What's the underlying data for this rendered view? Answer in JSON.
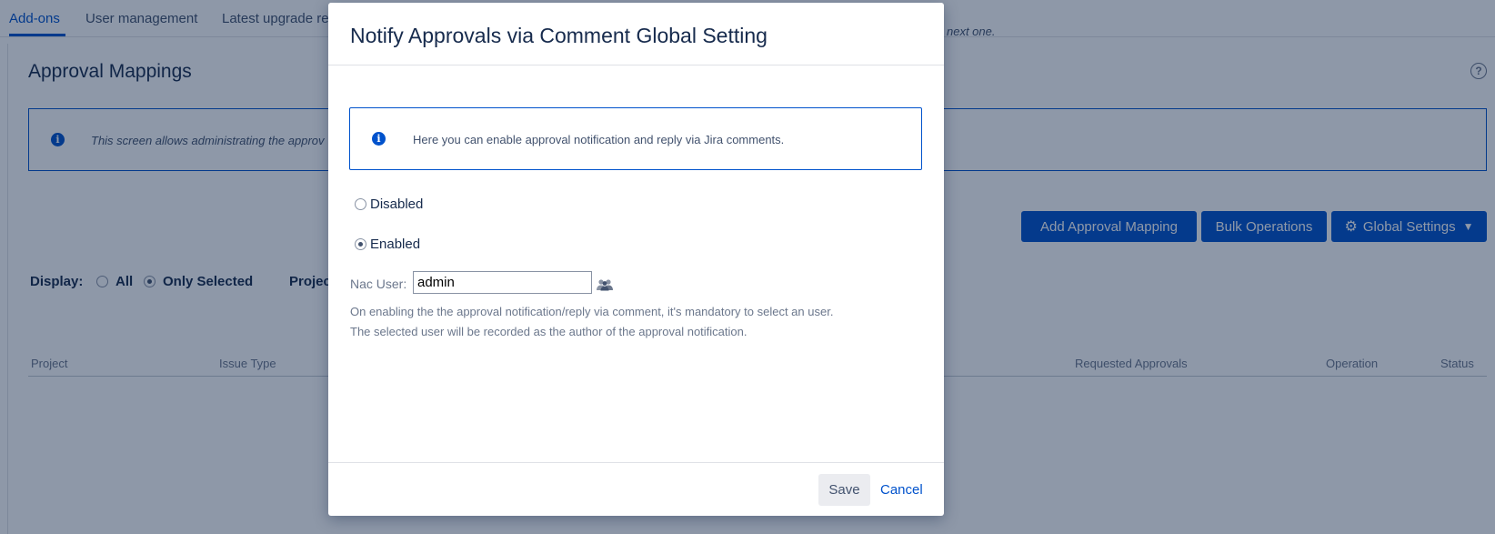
{
  "topnav": {
    "tabs": [
      {
        "label": "Add-ons",
        "active": true
      },
      {
        "label": "User management",
        "active": false
      },
      {
        "label": "Latest upgrade re",
        "active": false
      }
    ]
  },
  "page": {
    "title": "Approval Mappings",
    "help_icon": "question-circle-icon",
    "info_text_left": "This screen allows administrating the approv",
    "info_text_right": "next one.",
    "buttons": {
      "add": "Add Approval Mapping",
      "bulk": "Bulk Operations",
      "global": "Global Settings"
    },
    "display": {
      "label": "Display:",
      "options": [
        {
          "label": "All",
          "selected": false
        },
        {
          "label": "Only Selected",
          "selected": true
        }
      ]
    },
    "project_filter_label": "Projec",
    "table_headers": [
      "Project",
      "Issue Type",
      "Requested Approvals",
      "Operation",
      "Status"
    ]
  },
  "dialog": {
    "title": "Notify Approvals via Comment Global Setting",
    "info_text": "Here you can enable approval notification and reply via Jira comments.",
    "options": [
      {
        "label": "Disabled",
        "selected": false
      },
      {
        "label": "Enabled",
        "selected": true
      }
    ],
    "nac_user_label": "Nac User:",
    "nac_user_value": "admin",
    "user_picker_icon": "users-icon",
    "hint_line1": "On enabling the the approval notification/reply via comment, it's mandatory to select an user.",
    "hint_line2": "The selected user will be recorded as the author of the approval notification.",
    "save_label": "Save",
    "cancel_label": "Cancel"
  },
  "colors": {
    "accent": "#0052cc",
    "overlay": "#091e42",
    "text": "#172b4d",
    "muted": "#6b778c"
  }
}
